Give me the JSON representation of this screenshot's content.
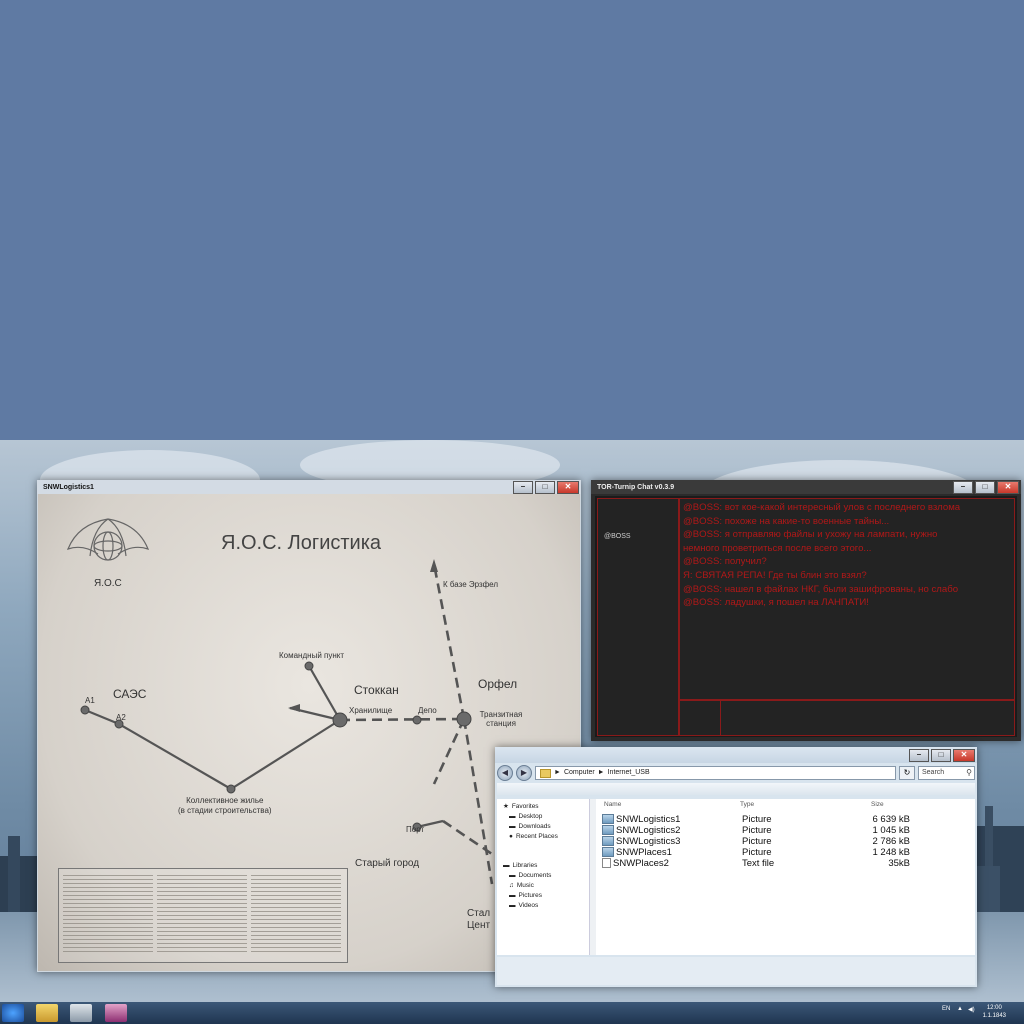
{
  "map_window": {
    "title": "SNWLogistics1",
    "map_title": "Я.О.С. Логистика",
    "logo_text": "Я.О.С",
    "labels": {
      "to_base": "К базе Эрзфел",
      "command_post": "Командный пункт",
      "stokkan": "Стоккан",
      "orfel": "Орфел",
      "saes": "САЭС",
      "a1": "А1",
      "a2": "А2",
      "storage": "Хранилище",
      "depot": "Депо",
      "transit_station": "Транзитная станция",
      "housing": "Коллективное жилье\n(в стадии строительства)",
      "port": "Порт",
      "old_town": "Старый город",
      "steel_center": "Стал\nЦент"
    }
  },
  "chat_window": {
    "title": "TOR-Turnip Chat v0.3.9",
    "users": [
      "@BOSS"
    ],
    "messages": [
      "@BOSS: вот кое-какой интересный улов с последнего взлома",
      "@BOSS: похоже на какие-то военные тайны...",
      "@BOSS: я отправляю файлы и ухожу на лампати, нужно",
      "немного проветриться после всего этого...",
      "@BOSS: получил?",
      "Я: СВЯТАЯ РЕПА! Где ты блин это взял?",
      "@BOSS: нашел в файлах НКГ, были зашифрованы, но слабо",
      "@BOSS: ладушки, я пошел на ЛАНПАТИ!"
    ]
  },
  "explorer_window": {
    "path": [
      "Computer",
      "Internet_USB"
    ],
    "search_placeholder": "Search",
    "nav": {
      "favorites_label": "Favorites",
      "favorites": [
        "Desktop",
        "Downloads",
        "Recent Places"
      ],
      "libraries_label": "Libraries",
      "libraries": [
        "Documents",
        "Music",
        "Pictures",
        "Videos"
      ]
    },
    "columns": {
      "name": "Name",
      "type": "Type",
      "size": "Size"
    },
    "files": [
      {
        "name": "SNWLogistics1",
        "type": "Picture",
        "size": "6 639 kB"
      },
      {
        "name": "SNWLogistics2",
        "type": "Picture",
        "size": "1 045 kB"
      },
      {
        "name": "SNWLogistics3",
        "type": "Picture",
        "size": "2 786 kB"
      },
      {
        "name": "SNWPlaces1",
        "type": "Picture",
        "size": "1 248 kB"
      },
      {
        "name": "SNWPlaces2",
        "type": "Text file",
        "size": "35kB"
      }
    ]
  },
  "taskbar": {
    "lang": "EN",
    "time": "12:00",
    "date": "1.1.1843"
  }
}
